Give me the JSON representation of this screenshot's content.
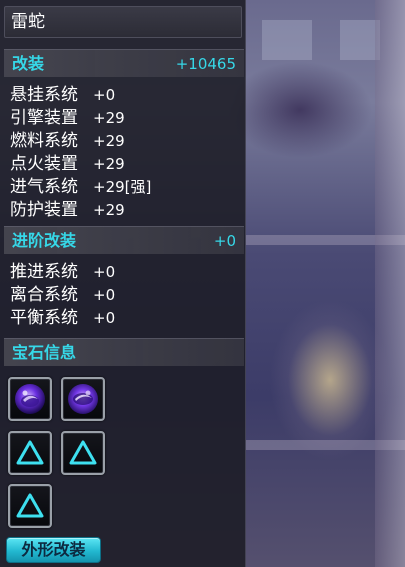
{
  "panel": {
    "title": "雷蛇"
  },
  "modification": {
    "header": "改装",
    "total": "+10465",
    "stats": [
      {
        "name": "悬挂系统",
        "value": "+0"
      },
      {
        "name": "引擎装置",
        "value": "+29"
      },
      {
        "name": "燃料系统",
        "value": "+29"
      },
      {
        "name": "点火装置",
        "value": "+29"
      },
      {
        "name": "进气系统",
        "value": "+29[强]"
      },
      {
        "name": "防护装置",
        "value": "+29"
      }
    ]
  },
  "advanced_modification": {
    "header": "进阶改装",
    "total": "+0",
    "stats": [
      {
        "name": "推进系统",
        "value": "+0"
      },
      {
        "name": "离合系统",
        "value": "+0"
      },
      {
        "name": "平衡系统",
        "value": "+0"
      }
    ]
  },
  "gems": {
    "header": "宝石信息",
    "slots": [
      {
        "icon": "purple-gem-icon",
        "filled": true
      },
      {
        "icon": "purple-gem-icon",
        "filled": true
      },
      {
        "icon": "empty-triangle-slot-icon",
        "filled": false
      },
      {
        "icon": "empty-triangle-slot-icon",
        "filled": false
      },
      {
        "icon": "empty-triangle-slot-icon",
        "filled": false
      }
    ]
  },
  "appearance_button": {
    "label": "外形改装"
  },
  "colors": {
    "accent": "#36d8e8",
    "panel_bg": "#1c1c26",
    "button": "#22b8d0"
  }
}
